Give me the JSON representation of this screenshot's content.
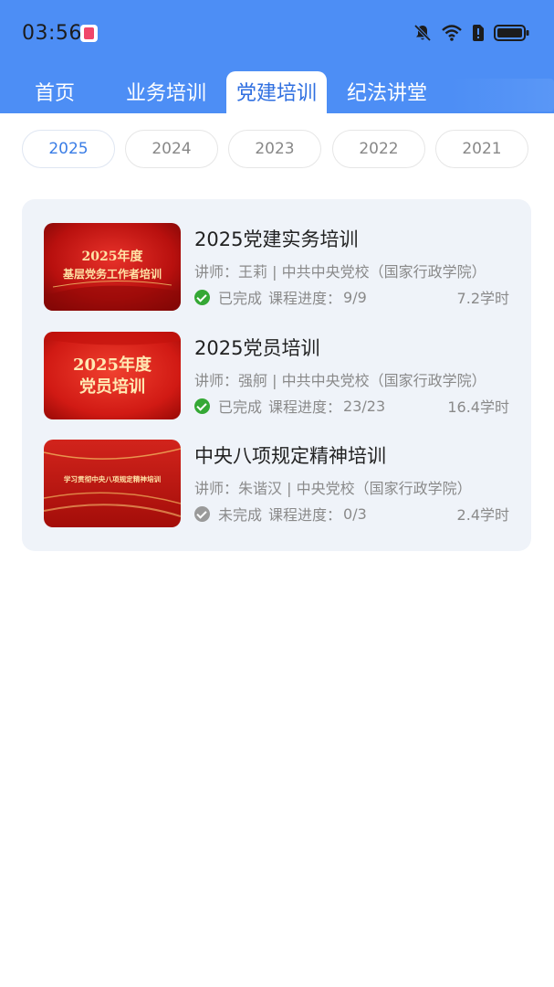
{
  "status_bar": {
    "time": "03:56",
    "icons": [
      "app-notification-icon",
      "mute-bell-icon",
      "wifi-icon",
      "alert-sim-icon",
      "battery-icon"
    ]
  },
  "tabs": [
    {
      "label": "首页",
      "active": false
    },
    {
      "label": "业务培训",
      "active": false
    },
    {
      "label": "党建培训",
      "active": true
    },
    {
      "label": "纪法讲堂",
      "active": false
    }
  ],
  "years": [
    {
      "label": "2025",
      "active": true
    },
    {
      "label": "2024",
      "active": false
    },
    {
      "label": "2023",
      "active": false
    },
    {
      "label": "2022",
      "active": false
    },
    {
      "label": "2021",
      "active": false
    }
  ],
  "courses": [
    {
      "title": "2025党建实务培训",
      "teacher": "讲师：王莉 | 中共中央党校（国家行政学院）",
      "status": "已完成",
      "progress_label": "课程进度：",
      "progress_value": "9/9",
      "hours": "7.2学时",
      "completed": true,
      "thumb_line1": "2025年度",
      "thumb_line2": "基层党务工作者培训"
    },
    {
      "title": "2025党员培训",
      "teacher": "讲师：强舸 | 中共中央党校（国家行政学院）",
      "status": "已完成",
      "progress_label": "课程进度：",
      "progress_value": "23/23",
      "hours": "16.4学时",
      "completed": true,
      "thumb_line1": "2025年度",
      "thumb_line2": "党员培训"
    },
    {
      "title": "中央八项规定精神培训",
      "teacher": "讲师：朱谐汉 | 中央党校（国家行政学院）",
      "status": "未完成",
      "progress_label": "课程进度：",
      "progress_value": "0/3",
      "hours": "2.4学时",
      "completed": false,
      "thumb_line1": "学习贯彻中央八项规定精神培训"
    }
  ],
  "colors": {
    "header_blue": "#4d8ef5",
    "active_blue": "#2f6fe0",
    "done_green": "#35a835",
    "todo_gray": "#9a9a9a",
    "panel_bg": "#eff3f9"
  }
}
